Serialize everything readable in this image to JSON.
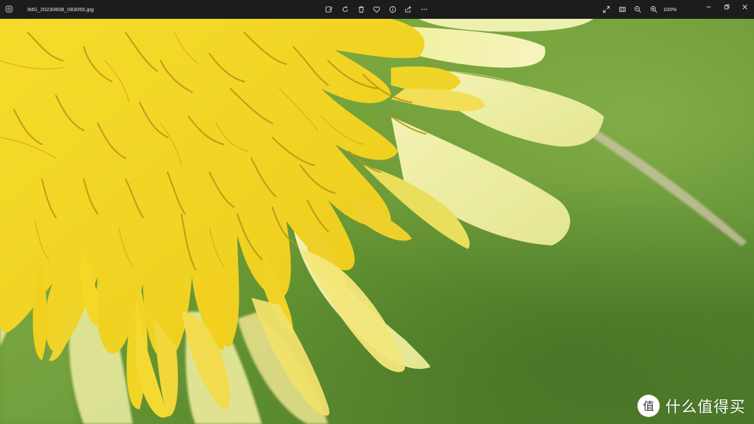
{
  "titlebar": {
    "file_name": "IMG_20230608_083055.jpg",
    "zoom_level": "100%",
    "app_icon": "photos-app-icon",
    "tools": [
      {
        "name": "edit-image-icon"
      },
      {
        "name": "rotate-icon"
      },
      {
        "name": "delete-icon"
      },
      {
        "name": "favorite-icon"
      },
      {
        "name": "file-info-icon"
      },
      {
        "name": "share-icon"
      },
      {
        "name": "more-options-icon"
      }
    ],
    "right_tools": [
      {
        "name": "fullscreen-icon"
      },
      {
        "name": "fit-to-window-icon"
      },
      {
        "name": "zoom-out-icon"
      },
      {
        "name": "zoom-in-icon"
      }
    ],
    "window_controls": [
      {
        "name": "minimize-icon"
      },
      {
        "name": "restore-icon"
      },
      {
        "name": "close-icon"
      }
    ]
  },
  "colors": {
    "toolbar_bg": "#1c1c1c",
    "petal_yellow": "#f2d832",
    "petal_pale": "#eef0a6",
    "background_green": "#5e8a2e"
  },
  "watermark": {
    "badge_glyph": "值",
    "text": "什么值得买"
  }
}
